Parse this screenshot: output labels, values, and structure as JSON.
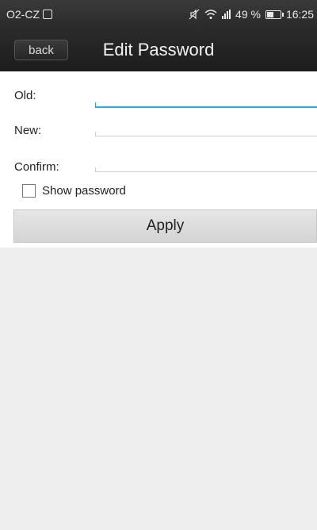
{
  "status_bar": {
    "carrier": "O2-CZ",
    "battery_percent": "49 %",
    "time": "16:25"
  },
  "header": {
    "back_label": "back",
    "title": "Edit Password"
  },
  "form": {
    "old_label": "Old:",
    "old_value": "",
    "new_label": "New:",
    "new_value": "",
    "confirm_label": "Confirm:",
    "confirm_value": "",
    "show_password_label": "Show password",
    "show_password_checked": false
  },
  "apply_label": "Apply",
  "colors": {
    "accent": "#37a6d8",
    "titlebar": "#222222",
    "background": "#eeeeee"
  }
}
